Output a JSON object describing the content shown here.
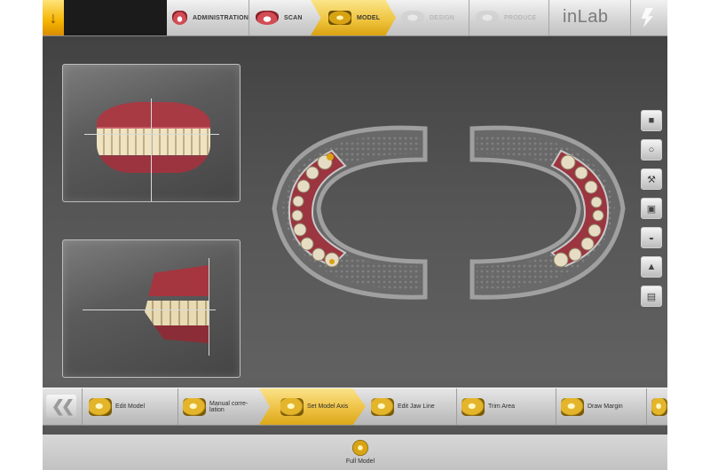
{
  "topbar": {
    "steps": [
      {
        "label": "ADMINISTRATION",
        "icon": "dentition-icon"
      },
      {
        "label": "SCAN",
        "icon": "dentition-icon"
      },
      {
        "label": "MODEL",
        "icon": "model-icon",
        "active": true
      },
      {
        "label": "DESIGN",
        "icon": "design-icon",
        "disabled": true
      },
      {
        "label": "PRODUCE",
        "icon": "produce-icon",
        "disabled": true
      }
    ],
    "brand": "inLab"
  },
  "toolbar": {
    "items": [
      {
        "label": "Edit Model"
      },
      {
        "label": "Manual corre-\nlation"
      },
      {
        "label": "Set Model Axis",
        "active": true
      },
      {
        "label": "Edit Jaw Line"
      },
      {
        "label": "Trim Area"
      },
      {
        "label": "Draw Margin"
      }
    ]
  },
  "bottombar": {
    "full_model": "Full Model"
  },
  "side_tools": [
    "cube-icon",
    "ring-icon",
    "tooth-tool-icon",
    "screen-icon",
    "jaw-icon",
    "blue-figure-icon",
    "book-icon"
  ]
}
